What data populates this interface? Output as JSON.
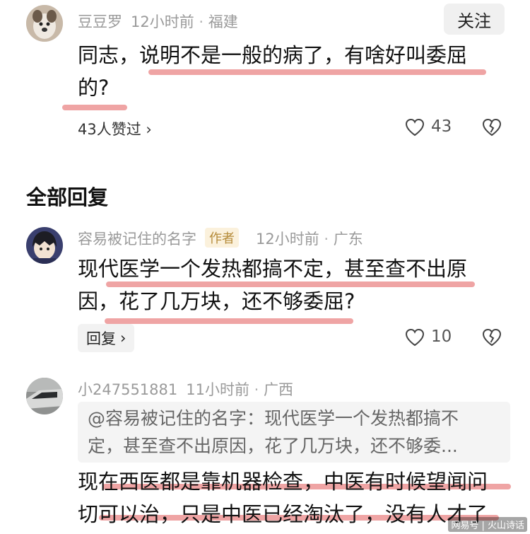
{
  "top_comment": {
    "username": "豆豆罗",
    "time": "12小时前",
    "location": "福建",
    "follow_label": "关注",
    "content_line1": "同志，说明不是一般的病了，有啥好叫委屈",
    "content_line2": "的?",
    "likes_text": "43人赞过",
    "like_count": "43"
  },
  "section_title": "全部回复",
  "replies": [
    {
      "username": "容易被记住的名字",
      "author_tag": "作者",
      "time": "12小时前",
      "location": "广东",
      "content_line1": "现代医学一个发热都搞不定，甚至查不出原",
      "content_line2": "因，花了几万块，还不够委屈?",
      "reply_label": "回复",
      "like_count": "10"
    },
    {
      "username": "小247551881",
      "time": "11小时前",
      "location": "广西",
      "quote_line1": "@容易被记住的名字：现代医学一个发热都搞不",
      "quote_line2": "定，甚至查不出原因，花了几万块，还不够委...",
      "content_line1": "现在西医都是靠机器检查，中医有时候望闻问",
      "content_line2": "切可以治，只是中医已经淘汰了，没有人才了"
    }
  ],
  "watermark": "网易号 | 火山诗话",
  "colors": {
    "highlight_red": "#e25a5a",
    "author_tag_bg": "#fbf1dc",
    "author_tag_text": "#b58b3a"
  }
}
